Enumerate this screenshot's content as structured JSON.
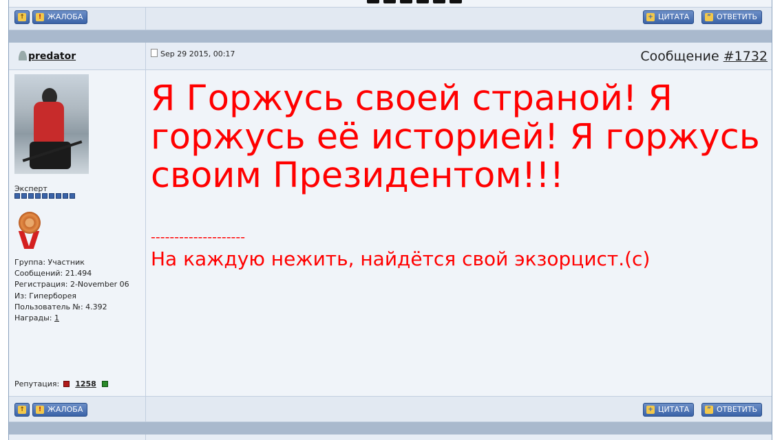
{
  "top_buttons": {
    "up_icon": "up-arrow-icon",
    "report_label": "ЖАЛОБА",
    "quote_label": "ЦИТАТА",
    "reply_label": "ОТВЕТИТЬ"
  },
  "post": {
    "username": "predator",
    "date": "Sep 29 2015, 00:17",
    "message_label": "Сообщение",
    "message_number": "#1732",
    "text": "Я Горжусь своей страной! Я горжусь её историей! Я горжусь своим Президентом!!!",
    "signature_line": "--------------------",
    "signature": "На каждую нежить, найдётся свой экзорцист.(с)"
  },
  "user": {
    "rank": "Эксперт",
    "rank_pips": 9,
    "group": "Группа: Участник",
    "posts": "Сообщений: 21.494",
    "registered": "Регистрация: 2-November 06",
    "from": "Из: Гиперборея",
    "user_no": "Пользователь №: 4.392",
    "awards_label": "Награды: ",
    "awards_value": "1",
    "reputation_label": "Репутация:",
    "reputation_value": "1258"
  },
  "bottom_buttons": {
    "report_label": "ЖАЛОБА",
    "quote_label": "ЦИТАТА",
    "reply_label": "ОТВЕТИТЬ"
  },
  "colors": {
    "post_text": "#ff0000",
    "button": "#3a63a8",
    "separator": "#a9b9cd"
  }
}
